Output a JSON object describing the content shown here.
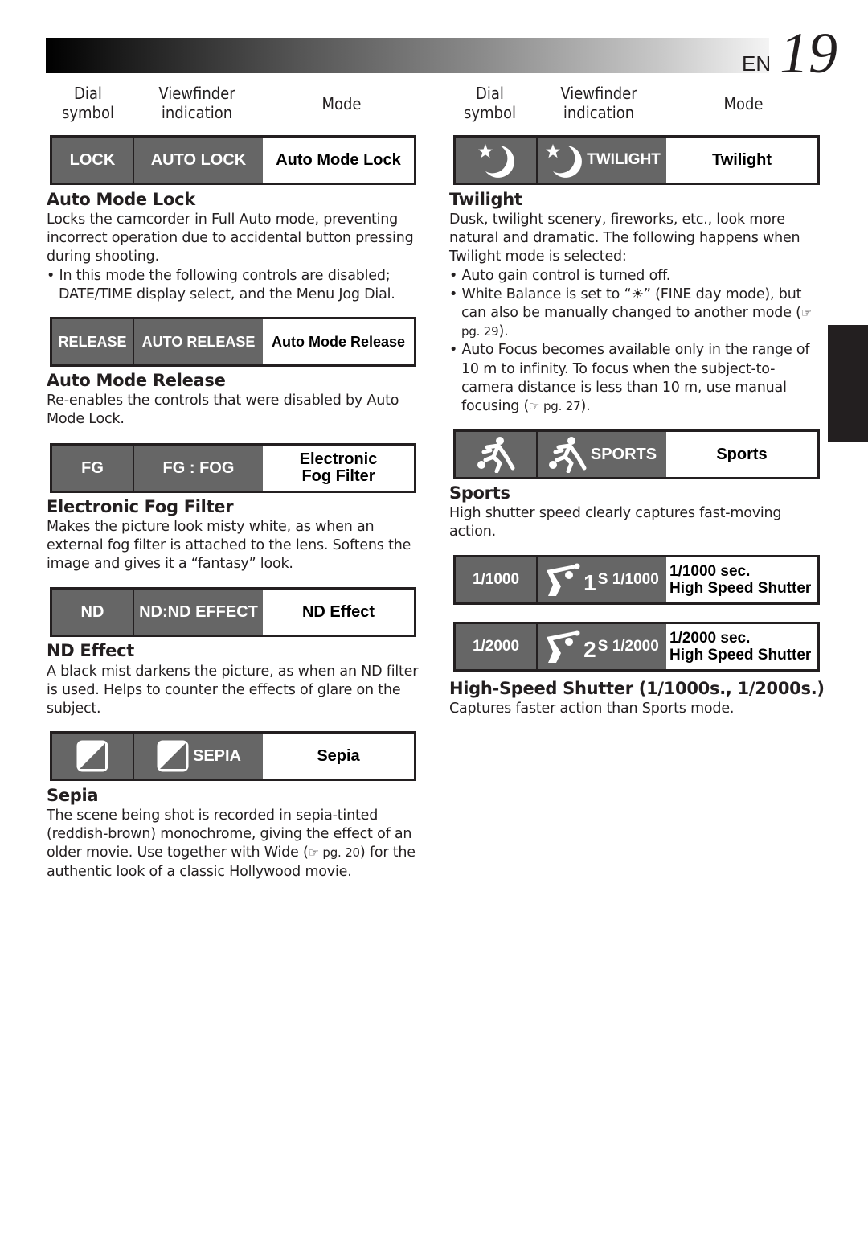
{
  "header": {
    "lang": "EN",
    "page_number": "19"
  },
  "column_headers": {
    "dial_symbol_line1": "Dial",
    "dial_symbol_line2": "symbol",
    "viewfinder_line1": "Viewfinder",
    "viewfinder_line2": "indication",
    "mode": "Mode"
  },
  "left": {
    "auto_mode_lock": {
      "dial": "LOCK",
      "viewfinder": "AUTO LOCK",
      "mode": "Auto Mode Lock",
      "title": "Auto Mode Lock",
      "body": "Locks the camcorder in Full Auto mode, preventing incorrect operation due to accidental button pressing during shooting.",
      "bullet": "In this mode the following controls are disabled; DATE/TIME display select, and the Menu Jog Dial."
    },
    "auto_mode_release": {
      "dial": "RELEASE",
      "viewfinder": "AUTO RELEASE",
      "mode": "Auto Mode Release",
      "title": "Auto Mode Release",
      "body": "Re-enables the controls that were disabled by Auto Mode Lock."
    },
    "fog": {
      "dial": "FG",
      "viewfinder": "FG : FOG",
      "mode_line1": "Electronic",
      "mode_line2": "Fog Filter",
      "title": "Electronic Fog Filter",
      "body": "Makes the picture look misty white, as when an external fog filter is attached to the lens. Softens the image and gives it a “fantasy” look."
    },
    "nd": {
      "dial": "ND",
      "viewfinder": "ND:ND EFFECT",
      "mode": "ND Effect",
      "title": "ND Effect",
      "body": "A black mist darkens the picture, as when an ND filter is used. Helps to counter the effects of glare on the subject."
    },
    "sepia": {
      "dial_icon": "sepia-icon",
      "viewfinder": "SEPIA",
      "mode": "Sepia",
      "title": "Sepia",
      "body_before_ref": "The scene being shot is recorded in sepia-tinted (reddish-brown) monochrome, giving the effect of an older movie. Use together with Wide (",
      "ref": "☞ pg. 20",
      "body_after_ref": ") for the authentic look of a classic Hollywood movie."
    }
  },
  "right": {
    "twilight": {
      "dial_icon": "twilight-icon",
      "viewfinder": "TWILIGHT",
      "mode": "Twilight",
      "title": "Twilight",
      "body": "Dusk, twilight scenery, fireworks, etc., look more natural and dramatic. The following happens when Twilight mode is selected:",
      "bullet1": "Auto gain control is turned off.",
      "bullet2_before": "White Balance is set to “",
      "bullet2_icon": "☀",
      "bullet2_after": "” (FINE day mode), but can also be manually changed to another mode (",
      "bullet2_ref": "☞ pg. 29",
      "bullet2_end": ").",
      "bullet3_before": "Auto Focus becomes available only in the range of 10 m to infinity. To focus when the subject-to-camera distance is less than 10 m, use manual focusing (",
      "bullet3_ref": "☞ pg. 27",
      "bullet3_end": ")."
    },
    "sports": {
      "dial_icon": "sports-icon",
      "viewfinder": "SPORTS",
      "mode": "Sports",
      "title": "Sports",
      "body": "High shutter speed clearly captures fast-moving action."
    },
    "shutter_1000": {
      "dial": "1/1000",
      "viewfinder_num": "1",
      "viewfinder": "S 1/1000",
      "mode_line1": "1/1000 sec.",
      "mode_line2": "High Speed Shutter"
    },
    "shutter_2000": {
      "dial": "1/2000",
      "viewfinder_num": "2",
      "viewfinder": "S 1/2000",
      "mode_line1": "1/2000 sec.",
      "mode_line2": "High Speed Shutter"
    },
    "high_speed": {
      "title": "High-Speed Shutter (1/1000s., 1/2000s.)",
      "body": "Captures faster action than Sports mode."
    }
  }
}
